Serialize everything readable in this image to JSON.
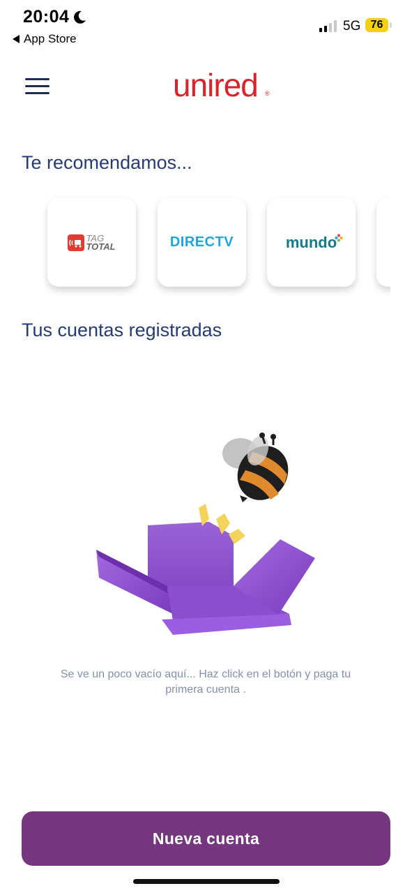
{
  "status_bar": {
    "time": "20:04",
    "back_label": "App Store",
    "network": "5G",
    "battery": "76"
  },
  "header": {
    "logo_text": "unired",
    "logo_reg": "®",
    "brand_color": "#d8232a"
  },
  "recommendations": {
    "title": "Te recomendamos...",
    "items": [
      {
        "name": "TAG TOTAL",
        "line1": "TAG",
        "line2": "TOTAL",
        "icon": "tag-total-logo"
      },
      {
        "name": "DIRECTV",
        "text": "DIRECTV",
        "icon": "directv-logo"
      },
      {
        "name": "mundo",
        "text": "mundo",
        "icon": "mundo-logo"
      }
    ]
  },
  "accounts": {
    "title": "Tus cuentas registradas",
    "empty_message": "Se ve un poco vacío aquí... Haz click en el botón y paga tu primera cuenta ."
  },
  "cta": {
    "label": "Nueva cuenta",
    "color": "#76367f"
  }
}
